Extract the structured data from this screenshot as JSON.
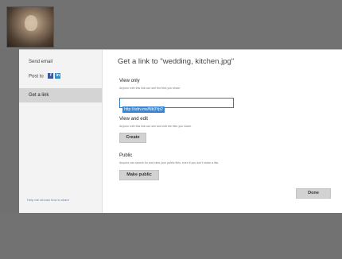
{
  "sidebar": {
    "items": [
      {
        "label": "Send email"
      },
      {
        "label": "Post to"
      },
      {
        "label": "Get a link"
      }
    ],
    "post_to_icons": [
      "facebook-icon",
      "linkedin-icon"
    ],
    "help_link": "Help me choose how to share"
  },
  "dialog": {
    "title": "Get a link to \"wedding, kitchen.jpg\"",
    "view_only": {
      "heading": "View only",
      "description": "Anyone with this link can see the files you share.",
      "link_value": "http://sdrv.ms/Nb3Yp2"
    },
    "view_and_edit": {
      "heading": "View and edit",
      "description": "Anyone with this link can see and edit the files you share.",
      "button": "Create"
    },
    "public": {
      "heading": "Public",
      "description": "Anyone can search for and view your public files, even if you don't share a link.",
      "button": "Make public"
    },
    "done_button": "Done"
  },
  "colors": {
    "backdrop": "#707070",
    "dialog_bg": "#ffffff",
    "sidebar_bg": "#f3f3f3",
    "sidebar_selected": "#d4d4d4",
    "link_selection": "#3b86d3",
    "button_bg": "#d2d2d2"
  }
}
